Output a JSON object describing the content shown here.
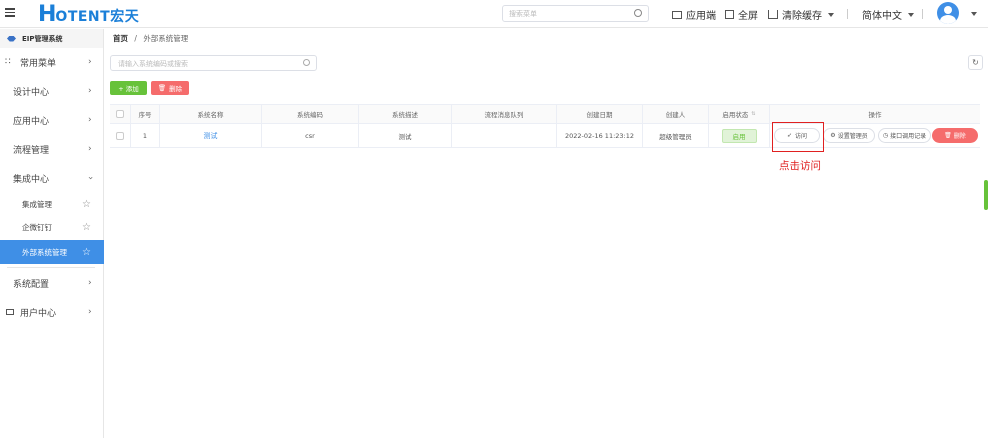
{
  "topbar": {
    "logo_h": "H",
    "logo_rest": "OTENT宏天",
    "search_placeholder": "搜索菜单",
    "app_label": "应用端",
    "fullscreen_label": "全屏",
    "clear_cache_label": "清除缓存",
    "language_label": "简体中文"
  },
  "sidebar": {
    "title": "EIP管理系统",
    "items": [
      {
        "label": "常用菜单"
      },
      {
        "label": "设计中心"
      },
      {
        "label": "应用中心"
      },
      {
        "label": "流程管理"
      },
      {
        "label": "集成中心"
      },
      {
        "label": "集成管理"
      },
      {
        "label": "企微钉钉"
      },
      {
        "label": "外部系统管理"
      },
      {
        "label": "系统配置"
      },
      {
        "label": "用户中心"
      }
    ]
  },
  "breadcrumb": {
    "home": "首页",
    "sep": "/",
    "current": "外部系统管理"
  },
  "main": {
    "search_placeholder": "请输入系统编码或搜索",
    "add_label": "+ 添加",
    "delete_label": "删除"
  },
  "table": {
    "headers": [
      "序号",
      "系统名称",
      "系统编码",
      "系统描述",
      "流程消息队列",
      "创建日期",
      "创建人",
      "启用状态",
      "操作"
    ],
    "rows": [
      {
        "index": "1",
        "name": "测试",
        "code": "csr",
        "desc": "测试",
        "queue": "",
        "created": "2022-02-16 11:23:12",
        "creator": "超级管理员",
        "status": "启用"
      }
    ],
    "ops": {
      "visit": "访问",
      "set_admin": "设置管理员",
      "api_log": "接口调用记录",
      "delete": "删除"
    }
  },
  "annotation": {
    "text": "点击访问"
  },
  "colors": {
    "brand": "#1b7fd8",
    "active": "#3f8fe6",
    "success": "#67c23a",
    "danger": "#f56c6c",
    "highlight": "#e02020"
  }
}
